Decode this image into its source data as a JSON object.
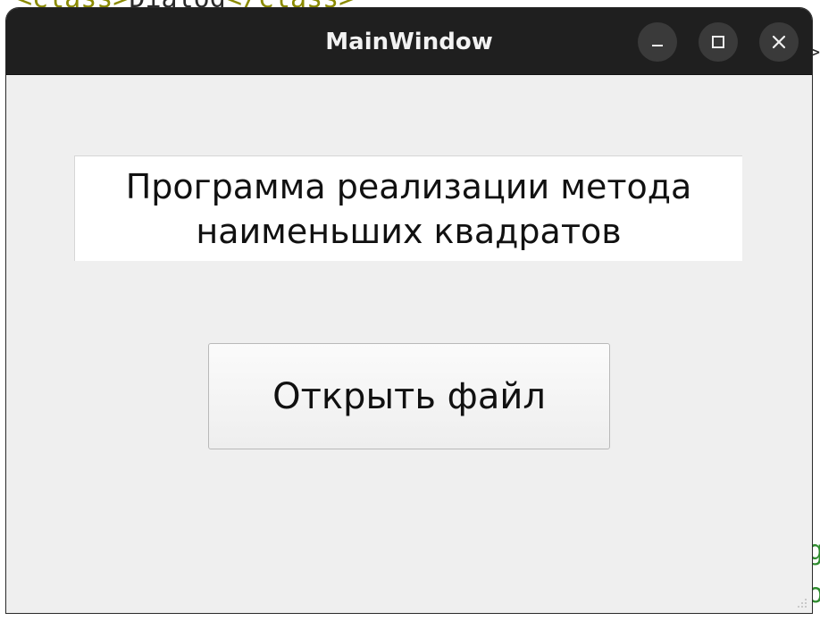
{
  "window": {
    "title": "MainWindow"
  },
  "title_bar_buttons": {
    "minimize_icon": "minimize-icon",
    "maximize_icon": "maximize-icon",
    "close_icon": "close-icon"
  },
  "main": {
    "heading": "Программа реализации метода\nнаименьших квадратов",
    "open_file_button": "Открыть файл"
  },
  "colors": {
    "titlebar": "#1f1f1f",
    "window_bg": "#efefef",
    "label_bg": "#ffffff"
  }
}
